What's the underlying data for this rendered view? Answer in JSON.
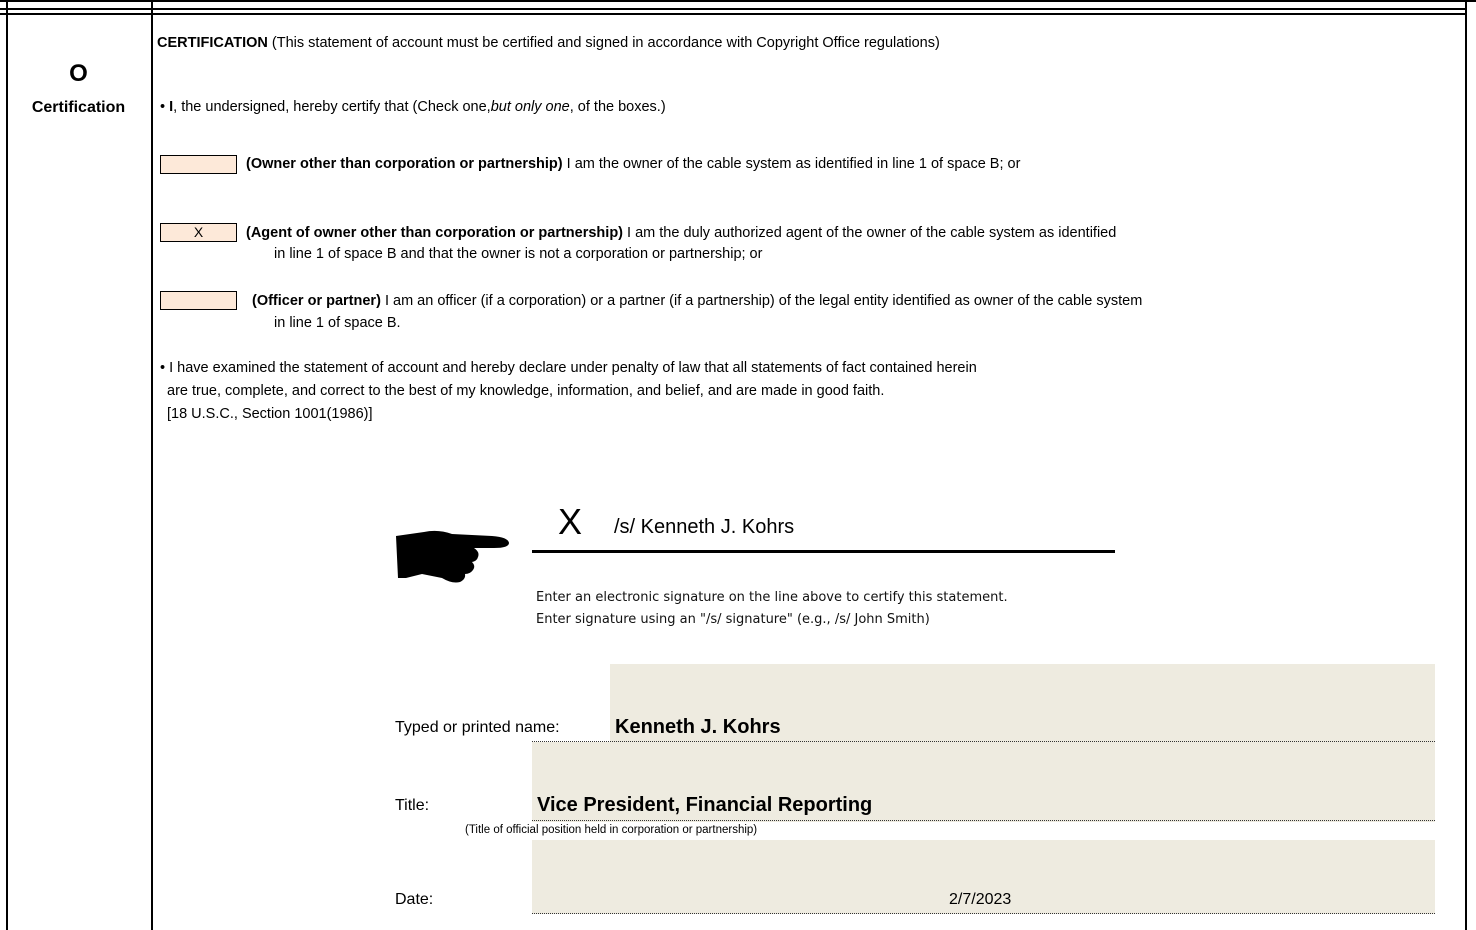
{
  "section": {
    "letter": "O",
    "name": "Certification"
  },
  "certification": {
    "heading": "CERTIFICATION",
    "heading_note": " (This statement of account must be certified and signed in accordance with Copyright Office regulations)",
    "intro_bullet": "• ",
    "intro_bold": "I",
    "intro_text": ", the undersigned, hereby certify that (Check one,",
    "intro_italic": "but only one",
    "intro_end": ", of the boxes.)"
  },
  "options": [
    {
      "checked_mark": "",
      "bold": "(Owner other than corporation or partnership)",
      "text": " I am the owner of the cable system as identified in line 1 of space B; or",
      "line2": ""
    },
    {
      "checked_mark": "X",
      "bold": "(Agent of owner other than corporation or partnership)",
      "text": " I am the duly authorized agent of the owner of the cable system as identified",
      "line2": "in line 1 of space B and that the owner is not a corporation or partnership; or"
    },
    {
      "checked_mark": "",
      "bold": "(Officer or partner)",
      "text": " I am an officer (if a corporation) or a partner (if a partnership) of the legal entity identified as owner of the cable system",
      "line2": "in line 1 of space B."
    }
  ],
  "declaration": {
    "line1": "• I have examined the statement of account and hereby declare under penalty of law that all statements of fact contained herein",
    "line2": "are true, complete, and correct to the best of my knowledge, information, and belief, and are made in good faith.",
    "line3": "[18 U.S.C., Section 1001(1986)]"
  },
  "signature": {
    "mark": "X",
    "value": "/s/ Kenneth J. Kohrs",
    "instruction1": "Enter an electronic signature on the line above to certify this statement.",
    "instruction2": "Enter signature using an \"/s/ signature\" (e.g.,  /s/ John Smith)",
    "icon": "pointing-hand-icon"
  },
  "fields": {
    "name_label": "Typed or printed name:",
    "name_value": "Kenneth J. Kohrs",
    "title_label": "Title:",
    "title_value": "Vice President, Financial Reporting",
    "title_hint": "(Title of official position held in corporation or partnership)",
    "date_label": "Date:",
    "date_value": "2/7/2023"
  },
  "colors": {
    "checkbox_fill": "#fde9d9",
    "field_fill": "#eeebe0"
  }
}
